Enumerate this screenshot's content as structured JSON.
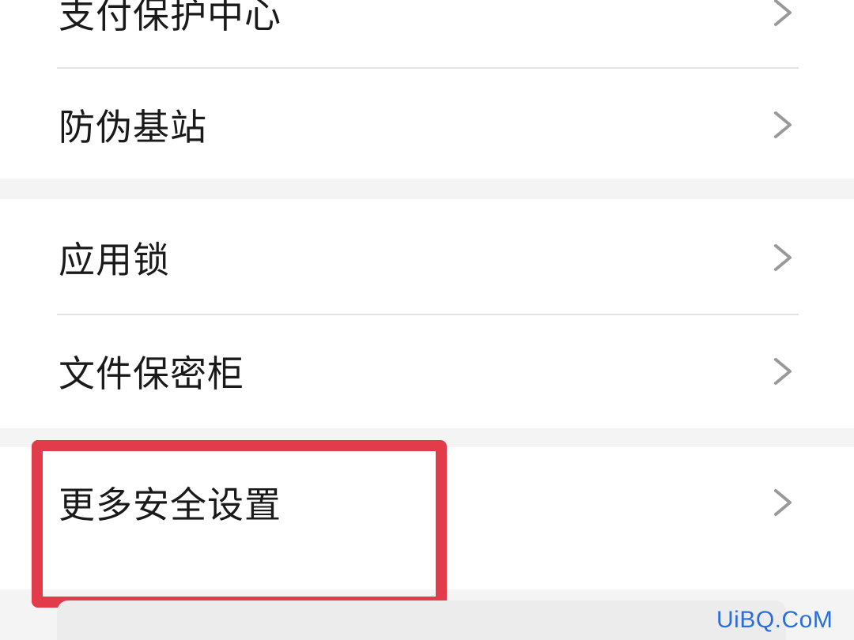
{
  "menu": {
    "group1": {
      "items": [
        {
          "label": "支付保护中心"
        },
        {
          "label": "防伪基站"
        }
      ]
    },
    "group2": {
      "items": [
        {
          "label": "应用锁"
        },
        {
          "label": "文件保密柜"
        }
      ]
    },
    "group3": {
      "items": [
        {
          "label": "更多安全设置"
        }
      ]
    }
  },
  "icons": {
    "row_arrow": "chevron-right-icon"
  },
  "colors": {
    "highlight": "#e23c4a",
    "watermark": "#2a6fd8"
  },
  "watermark": {
    "text": "UiBQ.CoM"
  }
}
